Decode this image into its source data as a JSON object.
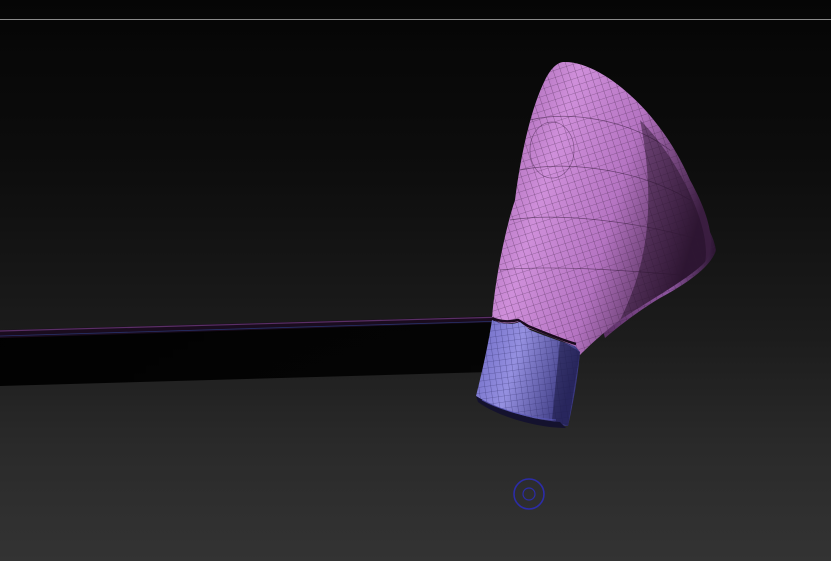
{
  "app": {
    "type": "3d-sculpting-viewport"
  },
  "viewport": {
    "background_top": "#050505",
    "background_bottom": "#333333",
    "top_rule_color": "#8a8a8a"
  },
  "model": {
    "name": "sleeve-mesh",
    "upper_color": "#c98ad4",
    "cuff_color": "#8a86d8",
    "wire_color": "#3a1e40",
    "visible": true
  },
  "cursor": {
    "type": "brush-cursor-icon",
    "color": "#2c2ca8"
  }
}
